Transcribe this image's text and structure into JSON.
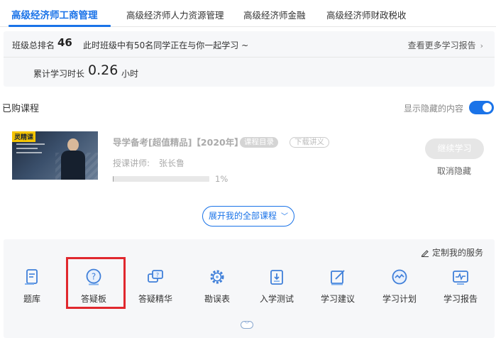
{
  "tabs": [
    {
      "label": "高级经济师工商管理",
      "active": true
    },
    {
      "label": "高级经济师人力资源管理",
      "active": false
    },
    {
      "label": "高级经济师金融",
      "active": false
    },
    {
      "label": "高级经济师财政税收",
      "active": false
    }
  ],
  "stats": {
    "rank_label": "班级总排名",
    "rank_value": "46",
    "rank_note": "此时班级中有50名同学正在与你一起学习 ~",
    "more_report": "查看更多学习报告",
    "study_time_label": "累计学习时长",
    "study_time_value": "0.26",
    "study_time_unit": "小时"
  },
  "purchased": {
    "title": "已购课程",
    "show_hidden_label": "显示隐藏的内容",
    "show_hidden_on": true
  },
  "course": {
    "thumb_badge": "灵精课",
    "title": "导学备考[超值精品]【2020年】",
    "tag_catalog": "课程目录",
    "tag_handout": "下载讲义",
    "teacher_label": "授课讲师:",
    "teacher_name": "张长鲁",
    "progress": 0.01,
    "progress_text": "1%",
    "continue_label": "继续学习",
    "cancel_hide_label": "取消隐藏"
  },
  "expand_label": "展开我的全部课程",
  "services": {
    "customize_label": "定制我的服务",
    "items": [
      {
        "label": "题库",
        "icon": "question-bank-icon",
        "color": "#3f7fd9"
      },
      {
        "label": "答疑板",
        "icon": "qa-board-icon",
        "color": "#3f7fd9"
      },
      {
        "label": "答疑精华",
        "icon": "qa-essence-icon",
        "color": "#3f7fd9"
      },
      {
        "label": "勘误表",
        "icon": "errata-gear-icon",
        "color": "#3f7fd9"
      },
      {
        "label": "入学测试",
        "icon": "entrance-test-icon",
        "color": "#3f7fd9"
      },
      {
        "label": "学习建议",
        "icon": "study-advice-icon",
        "color": "#3f7fd9"
      },
      {
        "label": "学习计划",
        "icon": "study-plan-icon",
        "color": "#3f7fd9"
      },
      {
        "label": "学习报告",
        "icon": "study-report-icon",
        "color": "#3f7fd9"
      }
    ]
  },
  "colors": {
    "accent": "#1a73e8",
    "highlight": "#e0282e"
  }
}
